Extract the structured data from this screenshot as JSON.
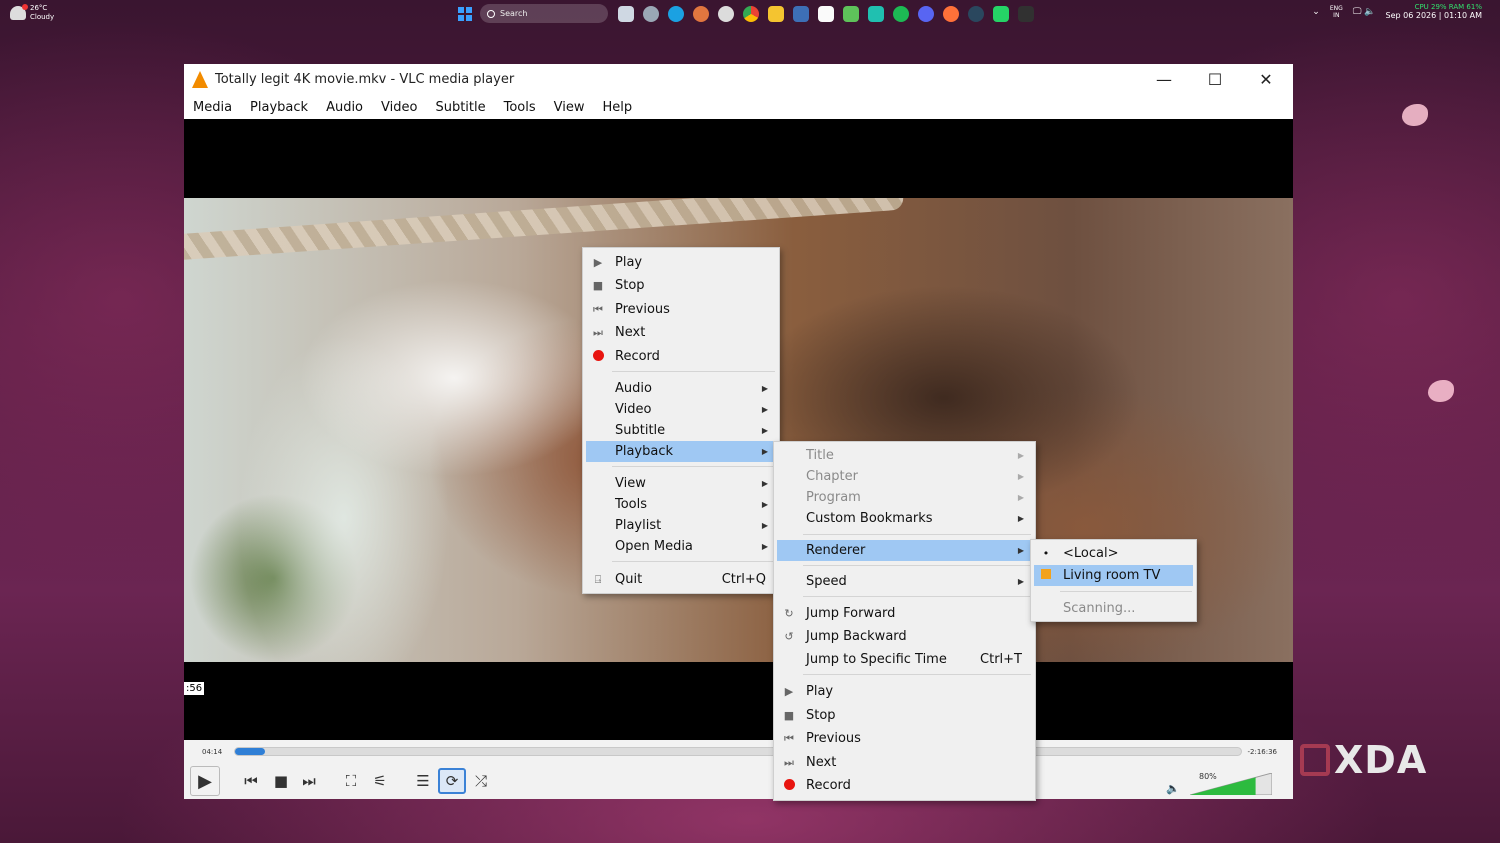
{
  "taskbar": {
    "weather": {
      "temp": "26°C",
      "condition": "Cloudy"
    },
    "search_placeholder": "Search",
    "apps": [
      "file-explorer",
      "steam",
      "edge",
      "claude",
      "chatgpt",
      "chrome",
      "folder",
      "task-manager",
      "calendar",
      "notepad",
      "app",
      "spotify",
      "discord",
      "firefox",
      "steam",
      "whatsapp",
      "epic"
    ],
    "tray": {
      "lang": "ENG",
      "region": "IN",
      "stats": "CPU 29% RAM 61%",
      "datetime": "Sep 06 2026 | 01:10 AM"
    }
  },
  "window": {
    "title": "Totally legit 4K movie.mkv - VLC media player",
    "controls": [
      "minimize",
      "maximize",
      "close"
    ]
  },
  "menubar": [
    "Media",
    "Playback",
    "Audio",
    "Video",
    "Subtitle",
    "Tools",
    "View",
    "Help"
  ],
  "main_menu": {
    "items": [
      {
        "label": "Play",
        "icon": "play-icon"
      },
      {
        "label": "Stop",
        "icon": "stop-icon"
      },
      {
        "label": "Previous",
        "icon": "previous-icon"
      },
      {
        "label": "Next",
        "icon": "next-icon"
      },
      {
        "label": "Record",
        "icon": "record-icon"
      },
      {
        "label": "Audio",
        "submenu": true
      },
      {
        "label": "Video",
        "submenu": true
      },
      {
        "label": "Subtitle",
        "submenu": true
      },
      {
        "label": "Playback",
        "submenu": true,
        "highlighted": true
      },
      {
        "label": "View",
        "submenu": true
      },
      {
        "label": "Tools",
        "submenu": true
      },
      {
        "label": "Playlist",
        "submenu": true
      },
      {
        "label": "Open Media",
        "submenu": true
      },
      {
        "label": "Quit",
        "shortcut": "Ctrl+Q",
        "icon": "quit-icon"
      }
    ]
  },
  "playback_menu": {
    "items": [
      {
        "label": "Title",
        "disabled": true
      },
      {
        "label": "Chapter",
        "disabled": true
      },
      {
        "label": "Program",
        "disabled": true
      },
      {
        "label": "Custom Bookmarks"
      },
      {
        "label": "Renderer",
        "highlighted": true
      },
      {
        "label": "Speed"
      },
      {
        "label": "Jump Forward",
        "icon": "jump-forward-icon"
      },
      {
        "label": "Jump Backward",
        "icon": "jump-backward-icon"
      },
      {
        "label": "Jump to Specific Time",
        "shortcut": "Ctrl+T"
      },
      {
        "label": "Play",
        "icon": "play-icon"
      },
      {
        "label": "Stop",
        "icon": "stop-icon"
      },
      {
        "label": "Previous",
        "icon": "previous-icon"
      },
      {
        "label": "Next",
        "icon": "next-icon"
      },
      {
        "label": "Record",
        "icon": "record-icon"
      }
    ]
  },
  "renderer_menu": {
    "items": [
      {
        "label": "<Local>",
        "selected": true
      },
      {
        "label": "Living room TV",
        "highlighted": true
      },
      {
        "label": "Scanning...",
        "disabled": true
      }
    ]
  },
  "player": {
    "tooltip_time": ":56",
    "elapsed": "04:14",
    "remaining": "-2:16:36",
    "progress": 0.03,
    "volume_label": "80%",
    "volume": 0.8
  },
  "colors": {
    "highlight": "#9fc8f3",
    "seek_fill": "#2f7fd6",
    "volume_fill": "#2dbb3f",
    "record": "#e8140f",
    "vlc_orange": "#f28b00"
  },
  "watermark": "XDA"
}
